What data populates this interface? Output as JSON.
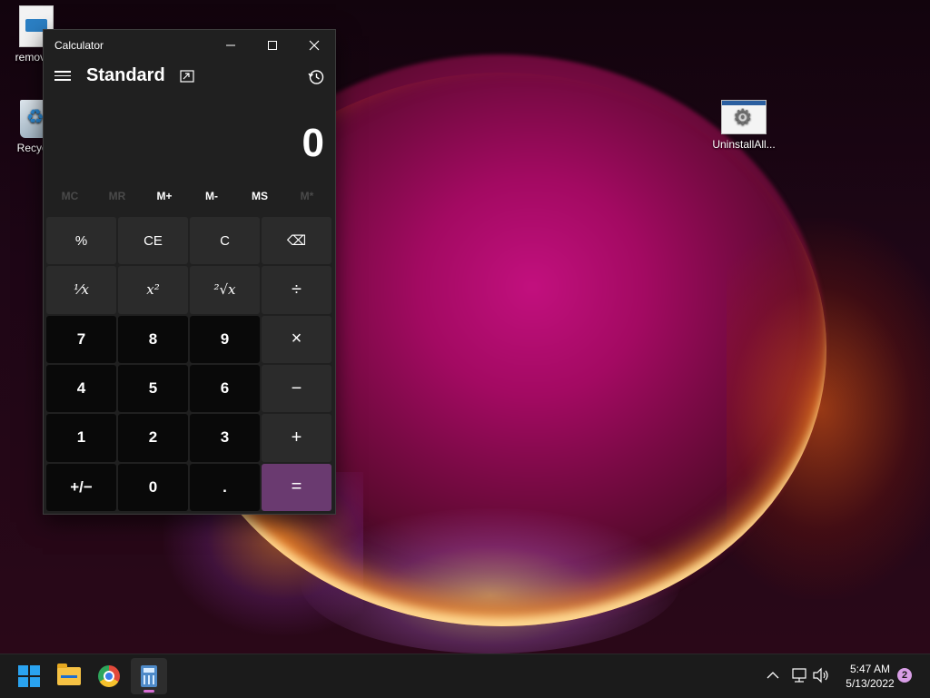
{
  "desktop": {
    "icons": [
      {
        "label": "remove_"
      },
      {
        "label": "Recycle"
      },
      {
        "label": "UninstallAll..."
      }
    ]
  },
  "calculator": {
    "window_title": "Calculator",
    "mode": "Standard",
    "display_value": "0",
    "memory_buttons": [
      {
        "label": "MC",
        "enabled": false
      },
      {
        "label": "MR",
        "enabled": false
      },
      {
        "label": "M+",
        "enabled": true
      },
      {
        "label": "M-",
        "enabled": true
      },
      {
        "label": "MS",
        "enabled": true
      },
      {
        "label": "M*",
        "enabled": false
      }
    ],
    "keys": {
      "percent": "%",
      "ce": "CE",
      "c": "C",
      "backspace": "⌫",
      "reciprocal": "⅟x",
      "square": "x²",
      "sqrt": "²√x",
      "divide": "÷",
      "seven": "7",
      "eight": "8",
      "nine": "9",
      "multiply": "×",
      "four": "4",
      "five": "5",
      "six": "6",
      "minus": "−",
      "one": "1",
      "two": "2",
      "three": "3",
      "plus": "+",
      "negate": "+/−",
      "zero": "0",
      "decimal": ".",
      "equals": "="
    },
    "accent_color": "#6a3a70"
  },
  "taskbar": {
    "pinned": [
      "start",
      "file-explorer",
      "chrome",
      "calculator"
    ],
    "clock_time": "5:47 AM",
    "clock_date": "5/13/2022",
    "notification_count": "2"
  }
}
